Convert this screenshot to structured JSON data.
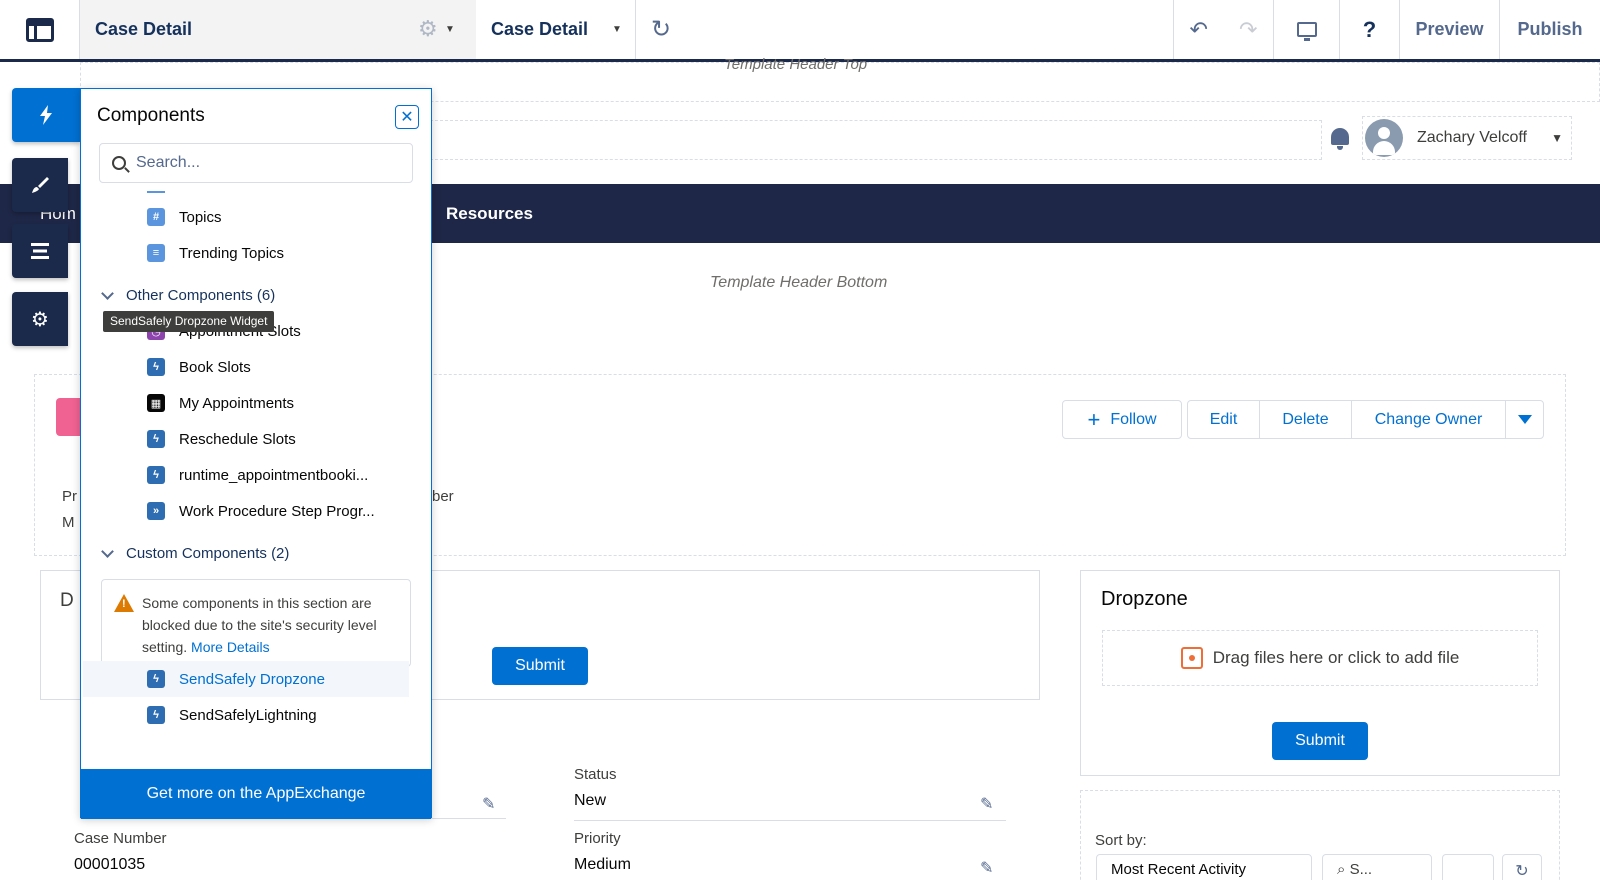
{
  "topbar": {
    "page_name": "Case Detail",
    "page_selector": "Case Detail",
    "preview_label": "Preview",
    "publish_label": "Publish",
    "help_label": "?"
  },
  "canvas": {
    "template_header_top": "Template Header Top",
    "template_header_bottom": "Template Header Bottom",
    "user_name": "Zachary Velcoff",
    "nav_items": [
      "Hom",
      "Resources"
    ],
    "actions": {
      "follow": "Follow",
      "edit": "Edit",
      "delete": "Delete",
      "change_owner": "Change Owner"
    },
    "fragments": {
      "label_pr": "Pr",
      "label_ber": "ber",
      "value_m": "M",
      "detail_d": "D"
    },
    "detail_submit": "Submit",
    "dropzone": {
      "title": "Dropzone",
      "drop_text": "Drag files here or click to add file",
      "submit": "Submit"
    },
    "fields": {
      "status_label": "Status",
      "status_value": "New",
      "case_number_label": "Case Number",
      "case_number_value": "00001035",
      "priority_label": "Priority",
      "priority_value": "Medium"
    },
    "feed": {
      "sort_label": "Sort by:",
      "sort_value": "Most Recent Activity",
      "search_placeholder": "S..."
    }
  },
  "panel": {
    "title": "Components",
    "search_placeholder": "Search...",
    "items_top": [
      {
        "label": "Topics",
        "icon": "hash-icon"
      },
      {
        "label": "Trending Topics",
        "icon": "list-icon"
      }
    ],
    "other_section": "Other Components (6)",
    "tooltip": "SendSafely Dropzone Widget",
    "other_items": [
      {
        "label": "Appointment Slots",
        "icon": "appointment-icon"
      },
      {
        "label": "Book Slots",
        "icon": "lightning-icon"
      },
      {
        "label": "My Appointments",
        "icon": "calendar-icon"
      },
      {
        "label": "Reschedule Slots",
        "icon": "lightning-icon"
      },
      {
        "label": "runtime_appointmentbooki...",
        "icon": "lightning-icon"
      },
      {
        "label": "Work Procedure Step Progr...",
        "icon": "step-icon"
      }
    ],
    "custom_section": "Custom Components (2)",
    "warning_text": "Some components in this section are blocked due to the site's security level setting.",
    "warning_link": "More Details",
    "custom_items": [
      {
        "label": "SendSafely Dropzone",
        "icon": "lightning-icon",
        "selected": true
      },
      {
        "label": "SendSafelyLightning",
        "icon": "lightning-icon",
        "selected": false
      }
    ],
    "footer": "Get more on the AppExchange"
  },
  "colors": {
    "brand": "#0070d2",
    "navy": "#1b2a4a",
    "nav_bar": "#1e2747"
  }
}
